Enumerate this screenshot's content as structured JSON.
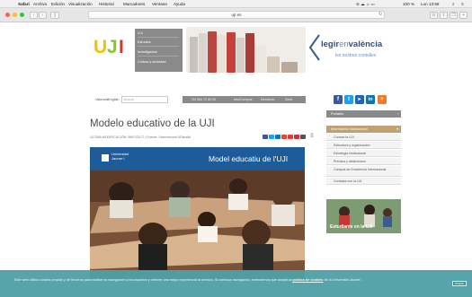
{
  "menubar": {
    "apple": "",
    "app": "Safari",
    "items": [
      "Archivo",
      "Edición",
      "Visualización",
      "Historial",
      "Marcadores",
      "Ventana",
      "Ayuda"
    ],
    "battery": "100 %",
    "clock": "Lun 13:58"
  },
  "toolbar": {
    "url": "ujI.es"
  },
  "site": {
    "logo": "UJI",
    "nav": [
      "UJI",
      "Estudios",
      "Investigación",
      "Cultura y sociedad"
    ],
    "banner_brand_pre": "legir",
    "banner_brand_en": "en",
    "banner_brand_post": "valència",
    "banner_sub": "les nostres contalles",
    "lang_items": [
      "Valencià",
      "English"
    ],
    "search_placeholder": "Buscar",
    "info_items": [
      "+34 964 72 80 00",
      "Info/Campus",
      "Directorio",
      "Sede"
    ],
    "social_icons": [
      "facebook-icon",
      "twitter-icon",
      "youtube-icon",
      "linkedin-icon",
      "add-icon"
    ]
  },
  "article": {
    "title": "Modelo educativo de la UJI",
    "meta": "ÚLTIMA MODIFICACIÓN: 06/07/2017 | Fuente: Vicerrectorat d'Estudis",
    "hero_brand_line1": "Universitat",
    "hero_brand_line2": "Jaume·I",
    "hero_caption": "Model educatiu de l'UJI"
  },
  "sidebar": {
    "head1": "Portales",
    "head2": "Información institucional",
    "items": [
      "Conoce la UJI",
      "Estructura y organización",
      "Estrategia institucional",
      "Premios y distinciones",
      "Campus de Excelencia Internacional",
      "Contacta con la UJI"
    ],
    "promo_caption": "Estudiante en la UJI"
  },
  "cookie": {
    "text": "Este web utiliza cookies propias y de terceros para facilitar la navegación a los usuarios y obtener una mejor experiencia al servicio. Si continúa navegando, entendemos que acepta la",
    "link": "política de cookies",
    "text2": "de la Universitat Jaume I",
    "button": "Acepto"
  },
  "colors": {
    "logo_yellow": "#f2c100",
    "logo_green": "#8cbf3f",
    "logo_red": "#d8362a",
    "nav_gray": "#8a8a8a",
    "hero_blue": "#1e5c99",
    "cookie_bg": "#4ea0a6"
  }
}
